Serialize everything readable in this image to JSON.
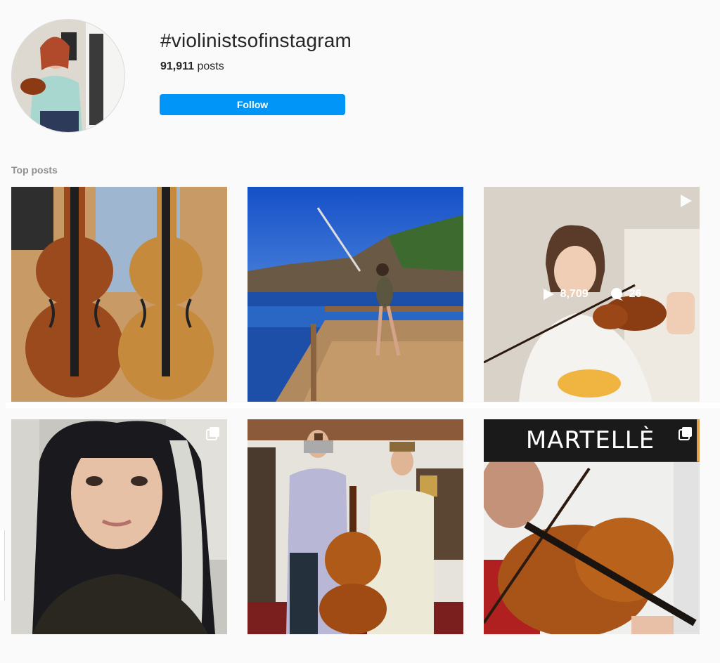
{
  "header": {
    "hashtag": "#violinistsofinstagram",
    "post_count": "91,911",
    "post_count_suffix": " posts",
    "follow_label": "Follow"
  },
  "section": {
    "label": "Top posts"
  },
  "posts": [
    {
      "alt": "two violins",
      "badge": ""
    },
    {
      "alt": "violinist on dock",
      "badge": ""
    },
    {
      "alt": "violin video",
      "badge": "video-icon",
      "plays": "8,709",
      "comments": "26"
    },
    {
      "alt": "portrait",
      "badge": "carousel-icon"
    },
    {
      "alt": "cello shop",
      "badge": ""
    },
    {
      "alt": "martelle lesson",
      "badge": "carousel-icon",
      "overlay_text": "MARTELLÈ"
    }
  ],
  "colors": {
    "accent": "#0095f6",
    "muted": "#8e8e8e"
  }
}
